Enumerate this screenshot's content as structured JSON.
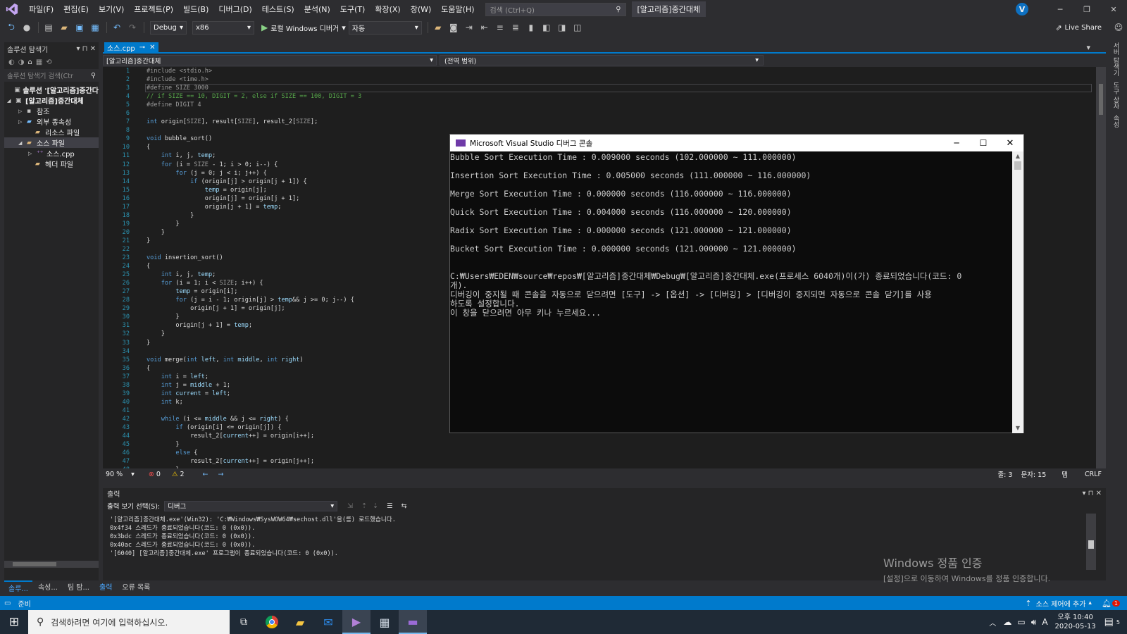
{
  "menubar": {
    "items": [
      "파일(F)",
      "편집(E)",
      "보기(V)",
      "프로젝트(P)",
      "빌드(B)",
      "디버그(D)",
      "테스트(S)",
      "분석(N)",
      "도구(T)",
      "확장(X)",
      "창(W)",
      "도움말(H)"
    ],
    "search_placeholder": "검색 (Ctrl+Q)",
    "solution_title": "[알고리즘]중간대체",
    "user_initial": "V"
  },
  "toolbar": {
    "config": "Debug",
    "platform": "x86",
    "run_label": "로컬 Windows 디버거",
    "auto_label": "자동",
    "live_share": "Live Share"
  },
  "solution_explorer": {
    "title": "솔루션 탐색기",
    "search_placeholder": "솔루션 탐색기 검색(Ctr",
    "items": [
      {
        "label": "솔루션 '[알고리즘]중간다"
      },
      {
        "label": "[알고리즘]중간대체"
      },
      {
        "label": "참조"
      },
      {
        "label": "외부 종속성"
      },
      {
        "label": "리소스 파일"
      },
      {
        "label": "소스 파일"
      },
      {
        "label": "소스.cpp"
      },
      {
        "label": "헤더 파일"
      }
    ],
    "bottom_tabs": [
      "솔루...",
      "속성...",
      "팀 탐...",
      "출력",
      "오류 목록"
    ]
  },
  "editor": {
    "tab_label": "소스.cpp",
    "scope_left": "[알고리즘]중간대체",
    "scope_right": "(전역 범위)",
    "zoom": "90 %",
    "errors": "0",
    "warnings": "2",
    "line_info": "줄: 3",
    "col_info": "문자: 15",
    "tab_mode": "탭",
    "eol": "CRLF",
    "lines": [
      "#include <stdio.h>",
      "#include <time.h>",
      "#define SIZE 3000",
      "// if SIZE == 10, DIGIT = 2, else if SIZE == 100, DIGIT = 3",
      "#define DIGIT 4",
      "",
      "int origin[SIZE], result[SIZE], result_2[SIZE];",
      "",
      "void bubble_sort()",
      "{",
      "    int i, j, temp;",
      "    for (i = SIZE - 1; i > 0; i--) {",
      "        for (j = 0; j < i; j++) {",
      "            if (origin[j] > origin[j + 1]) {",
      "                temp = origin[j];",
      "                origin[j] = origin[j + 1];",
      "                origin[j + 1] = temp;",
      "            }",
      "        }",
      "    }",
      "}",
      "",
      "void insertion_sort()",
      "{",
      "    int i, j, temp;",
      "    for (i = 1; i < SIZE; i++) {",
      "        temp = origin[i];",
      "        for (j = i - 1; origin[j] > temp&& j >= 0; j--) {",
      "            origin[j + 1] = origin[j];",
      "        }",
      "        origin[j + 1] = temp;",
      "    }",
      "}",
      "",
      "void merge(int left, int middle, int right)",
      "{",
      "    int i = left;",
      "    int j = middle + 1;",
      "    int current = left;",
      "    int k;",
      "",
      "    while (i <= middle && j <= right) {",
      "        if (origin[i] <= origin[j]) {",
      "            result_2[current++] = origin[i++];",
      "        }",
      "        else {",
      "            result_2[current++] = origin[j++];",
      "        }"
    ]
  },
  "console": {
    "title": "Microsoft Visual Studio 디버그 콘솔",
    "lines": [
      "Bubble Sort Execution Time : 0.009000 seconds (102.000000 ~ 111.000000)",
      "",
      "Insertion Sort Execution Time : 0.005000 seconds (111.000000 ~ 116.000000)",
      "",
      "Merge Sort Execution Time : 0.000000 seconds (116.000000 ~ 116.000000)",
      "",
      "Quick Sort Execution Time : 0.004000 seconds (116.000000 ~ 120.000000)",
      "",
      "Radix Sort Execution Time : 0.000000 seconds (121.000000 ~ 121.000000)",
      "",
      "Bucket Sort Execution Time : 0.000000 seconds (121.000000 ~ 121.000000)",
      "",
      "",
      "C:₩Users₩EDEN₩source₩repos₩[알고리즘]중간대체₩Debug₩[알고리즘]중간대체.exe(프로세스 6040개)이(가) 종료되었습니다(코드: 0",
      "개).",
      "디버깅이 중지될 때 콘솔을 자동으로 닫으려면 [도구] -> [옵션] -> [디버깅] > [디버깅이 중지되면 자동으로 콘솔 닫기]를 사용",
      "하도록 설정합니다.",
      "이 창을 닫으려면 아무 키나 누르세요..."
    ]
  },
  "output": {
    "title": "출력",
    "source_label": "출력 보기 선택(S):",
    "source_value": "디버그",
    "lines": [
      "'[알고리즘]중간대체.exe'(Win32): 'C:₩Windows₩SysWOW64₩sechost.dll'을(를) 로드했습니다.",
      "0x4f34 스레드가 종료되었습니다(코드: 0 (0x0)).",
      "0x3bdc 스레드가 종료되었습니다(코드: 0 (0x0)).",
      "0x40ac 스레드가 종료되었습니다(코드: 0 (0x0)).",
      "'[6040] [알고리즘]중간대체.exe' 프로그램이 종료되었습니다(코드: 0 (0x0))."
    ]
  },
  "watermark": {
    "title": "Windows 정품 인증",
    "subtitle": "[설정]으로 이동하여 Windows를 정품 인증합니다."
  },
  "statusbar": {
    "ready": "준비",
    "source_control": "소스 제어에 추가",
    "notif_count": "1"
  },
  "taskbar": {
    "search_placeholder": "검색하려면 여기에 입력하십시오.",
    "time": "오후 10:40",
    "date": "2020-05-13",
    "ime": "A",
    "notif_count": "5"
  },
  "right_rail": [
    "서버 탐색기",
    "도구 상자",
    "속성"
  ],
  "colors": {
    "accent": "#007acc",
    "console_bg": "#0c0c0c",
    "editor_bg": "#1e1e1e"
  }
}
